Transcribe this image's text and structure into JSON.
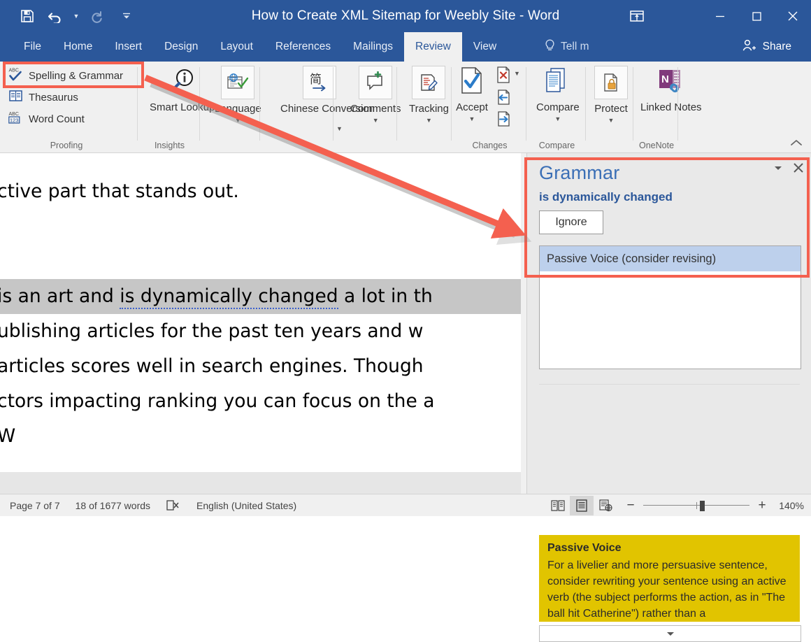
{
  "window": {
    "title": "How to Create XML Sitemap for Weebly Site - Word",
    "quick_access": [
      "save-icon",
      "undo-icon",
      "redo-icon",
      "customize-qat-icon"
    ],
    "upload_icon": "ribbon-display-options-icon",
    "controls": [
      "minimize",
      "maximize",
      "close"
    ],
    "share_label": "Share"
  },
  "tabs": [
    {
      "label": "File",
      "active": false
    },
    {
      "label": "Home",
      "active": false
    },
    {
      "label": "Insert",
      "active": false
    },
    {
      "label": "Design",
      "active": false
    },
    {
      "label": "Layout",
      "active": false
    },
    {
      "label": "References",
      "active": false
    },
    {
      "label": "Mailings",
      "active": false
    },
    {
      "label": "Review",
      "active": true
    },
    {
      "label": "View",
      "active": false
    }
  ],
  "tell_me": {
    "label": "Tell m",
    "icon": "lightbulb-icon"
  },
  "ribbon": {
    "groups": [
      {
        "name": "Proofing",
        "label": "Proofing",
        "small_buttons": [
          {
            "label": "Spelling & Grammar",
            "icon": "spelling-grammar-icon"
          },
          {
            "label": "Thesaurus",
            "icon": "thesaurus-icon"
          },
          {
            "label": "Word Count",
            "icon": "word-count-icon"
          }
        ]
      },
      {
        "name": "Insights",
        "label": "Insights",
        "big_buttons": [
          {
            "label": "Smart Lookup",
            "icon": "smart-lookup-icon",
            "dropdown": false
          }
        ]
      },
      {
        "name": "Language",
        "label": "",
        "big_buttons": [
          {
            "label": "Language",
            "icon": "language-icon",
            "dropdown": true
          }
        ]
      },
      {
        "name": "Chinese Conversion",
        "label": "",
        "big_buttons": [
          {
            "label": "Chinese Conversion",
            "icon": "chinese-conversion-icon",
            "dropdown": true
          }
        ]
      },
      {
        "name": "Comments",
        "label": "",
        "big_buttons": [
          {
            "label": "Comments",
            "icon": "new-comment-icon",
            "dropdown": true
          }
        ]
      },
      {
        "name": "Tracking",
        "label": "",
        "big_buttons": [
          {
            "label": "Tracking",
            "icon": "track-changes-icon",
            "dropdown": true
          }
        ]
      },
      {
        "name": "Changes",
        "label": "Changes",
        "big_buttons": [
          {
            "label": "Accept",
            "icon": "accept-change-icon",
            "dropdown": true
          }
        ],
        "side_buttons": [
          {
            "icon": "reject-change-icon",
            "dropdown": true
          },
          {
            "icon": "previous-change-icon",
            "dropdown": false
          },
          {
            "icon": "next-change-icon",
            "dropdown": false
          }
        ]
      },
      {
        "name": "Compare",
        "label": "Compare",
        "big_buttons": [
          {
            "label": "Compare",
            "icon": "compare-documents-icon",
            "dropdown": true
          }
        ]
      },
      {
        "name": "Protect",
        "label": "",
        "big_buttons": [
          {
            "label": "Protect",
            "icon": "protect-document-icon",
            "dropdown": true
          }
        ]
      },
      {
        "name": "OneNote",
        "label": "OneNote",
        "big_buttons": [
          {
            "label": "Linked Notes",
            "icon": "onenote-linked-notes-icon",
            "dropdown": false
          }
        ]
      }
    ],
    "collapse_icon": "chevron-up-icon"
  },
  "document": {
    "lines": [
      {
        "text": "ctive part that stands out.",
        "highlighted": false
      },
      {
        "text": "",
        "highlighted": false
      },
      {
        "text": "",
        "highlighted": false
      },
      {
        "text": "is an art and is dynamically changed a lot in th",
        "highlighted": true,
        "underline_from": "is dynamically changed"
      },
      {
        "text": "ublishing articles for the past ten years and w",
        "highlighted": false
      },
      {
        "text": " articles scores well in search engines. Though",
        "highlighted": false
      },
      {
        "text": "ctors impacting ranking you can focus on the a",
        "highlighted": false
      },
      {
        "text": "W",
        "highlighted": false
      }
    ]
  },
  "grammar_pane": {
    "title": "Grammar",
    "phrase": "is dynamically changed",
    "ignore_label": "Ignore",
    "suggestions": [
      {
        "label": "Passive Voice (consider revising)",
        "selected": true
      }
    ],
    "explanation": {
      "title": "Passive Voice",
      "body": "For a livelier and more persuasive sentence, consider rewriting your sentence using an active verb (the subject performs the action, as in \"The ball hit Catherine\") rather than a"
    },
    "minimize_icon": "chevron-down-icon",
    "close_icon": "close-icon",
    "scroll_down_icon": "chevron-down-icon"
  },
  "status_bar": {
    "page": "Page 7 of 7",
    "words": "18 of 1677 words",
    "proofing_icon": "proofing-errors-icon",
    "language": "English (United States)",
    "views": [
      {
        "icon": "read-mode-icon",
        "active": false
      },
      {
        "icon": "print-layout-icon",
        "active": true
      },
      {
        "icon": "web-layout-icon",
        "active": false
      }
    ],
    "zoom_out_icon": "minus-icon",
    "zoom_in_icon": "plus-icon",
    "zoom_level": "140%"
  },
  "annotations": {
    "highlight_color": "#f4604f",
    "boxes": [
      {
        "name": "spelling-grammar-highlight"
      },
      {
        "name": "grammar-pane-highlight"
      }
    ],
    "arrow": {
      "name": "pointer-arrow"
    }
  },
  "colors": {
    "brand_blue": "#2b579a",
    "ribbon_bg": "#f0f0f0",
    "pane_bg": "#e9e9e9",
    "selection_blue": "#bdd0ec",
    "explain_yellow": "#e1c400",
    "annotation_red": "#f4604f"
  }
}
